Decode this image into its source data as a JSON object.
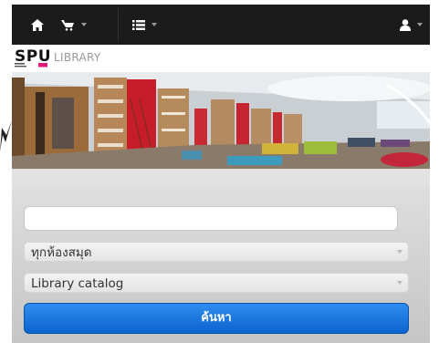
{
  "navbar": {
    "icons": [
      "home-icon",
      "cart-icon",
      "list-icon",
      "user-icon"
    ],
    "background": "#1b1b1b"
  },
  "logo": {
    "brand": "SPU",
    "library": "LIBRARY"
  },
  "search": {
    "placeholder": "",
    "value": ""
  },
  "library_select": {
    "selected": "ทุกห้องสมุด"
  },
  "catalog_select": {
    "selected": "Library catalog"
  },
  "button": {
    "label": "ค้นหา",
    "color": "#1f7ae0"
  },
  "colors": {
    "accent_pink": "#e0197b",
    "panel": "#d6d6d6"
  }
}
